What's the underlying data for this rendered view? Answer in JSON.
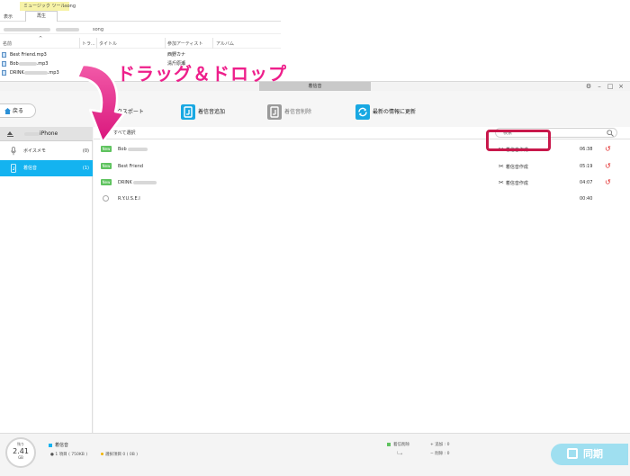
{
  "explorer": {
    "context_tab": "ミュージック ツール",
    "folder": "song",
    "tabs": [
      "表示",
      "再生"
    ],
    "address_part": "song",
    "columns": [
      "名前",
      "トラ...",
      "タイトル",
      "参加アーティスト",
      "アルバム"
    ],
    "files": [
      {
        "name": "Best Friend.mp3",
        "artist": "西野カナ"
      },
      {
        "name": "Bob",
        "suffix": ".mp3",
        "artist": "清斤原瀬"
      },
      {
        "name": "DRINK",
        "suffix": ".mp3",
        "artist": ""
      }
    ]
  },
  "drag_hint": "ドラッグ＆ドロップ",
  "app": {
    "window_title": "着信音",
    "back_label": "戻る",
    "toolbar": {
      "export": "エクスポート",
      "add": "着信音追加",
      "delete": "着信音削除",
      "refresh": "最新の情報に更新"
    },
    "device_name": "iPhone",
    "sidebar": [
      {
        "label": "ボイスメモ",
        "count": "(0)"
      },
      {
        "label": "着信音",
        "count": "(1)"
      }
    ],
    "select_all": "すべて選択",
    "search_placeholder": "検索",
    "rows": [
      {
        "badge": "New",
        "title": "Bob",
        "action": "着信音作成",
        "duration": "06:38"
      },
      {
        "badge": "New",
        "title": "Best Friend",
        "action": "着信音作成",
        "duration": "05:19"
      },
      {
        "badge": "New",
        "title": "DRINK",
        "action": "着信音作成",
        "duration": "04:07"
      },
      {
        "badge": "",
        "title": "R.Y.U.S.E.I",
        "action": "",
        "duration": "00:40"
      }
    ],
    "status": {
      "storage_label": "残り",
      "storage_value": "2.41",
      "storage_unit": "GB",
      "category": "着信音",
      "summary": "1 項目 ( 750KB )",
      "selected": "選択項目 0 ( 0B )",
      "ops_label": "着信削除",
      "added": "追加 : 0",
      "removed": "削除 : 0",
      "sync": "同期"
    }
  }
}
